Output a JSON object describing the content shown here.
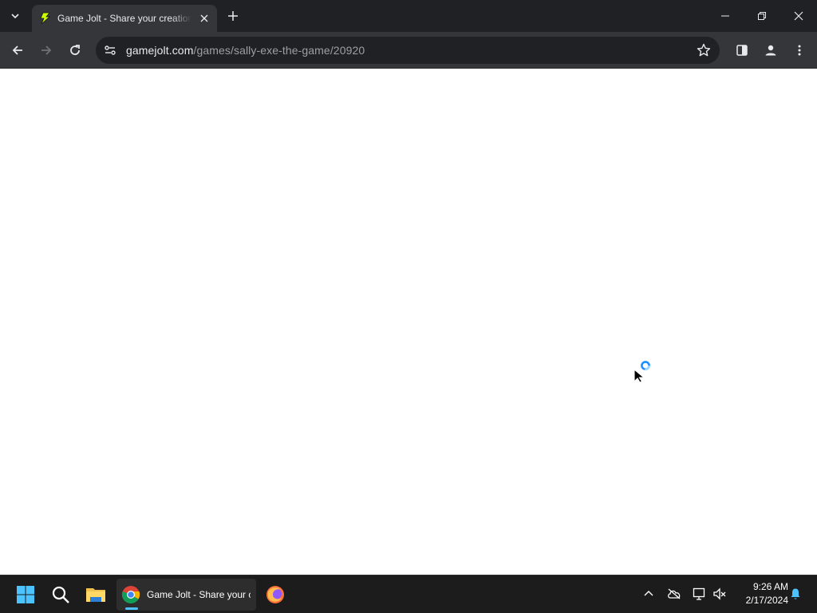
{
  "browser": {
    "tab": {
      "title": "Game Jolt - Share your creations",
      "favicon": "gamejolt-bolt-icon"
    },
    "address_bar": {
      "host": "gamejolt.com",
      "path": "/games/sally-exe-the-game/20920"
    },
    "window_controls": [
      "minimize",
      "restore",
      "close"
    ]
  },
  "page": {
    "state": "loading",
    "background": "#ffffff"
  },
  "cursor": {
    "type": "busy-arrow"
  },
  "taskbar": {
    "apps": [
      {
        "name": "start-button",
        "icon": "windows-logo-icon"
      },
      {
        "name": "search",
        "icon": "search-icon"
      },
      {
        "name": "file-explorer",
        "icon": "folder-icon"
      },
      {
        "name": "chrome",
        "icon": "chrome-icon",
        "label": "Game Jolt - Share your creations",
        "active": true
      },
      {
        "name": "firefox",
        "icon": "firefox-icon"
      }
    ],
    "tray": {
      "icons": [
        "chevron-up-icon",
        "onedrive-offline-icon",
        "network-icon",
        "volume-muted-icon",
        "notification-bell-icon"
      ]
    },
    "clock": {
      "time": "9:26 AM",
      "date": "2/17/2024"
    }
  },
  "colors": {
    "chrome_dark": "#202124",
    "chrome_toolbar": "#35363a",
    "taskbar": "#1c1c1c",
    "accent": "#4cc2ff"
  }
}
